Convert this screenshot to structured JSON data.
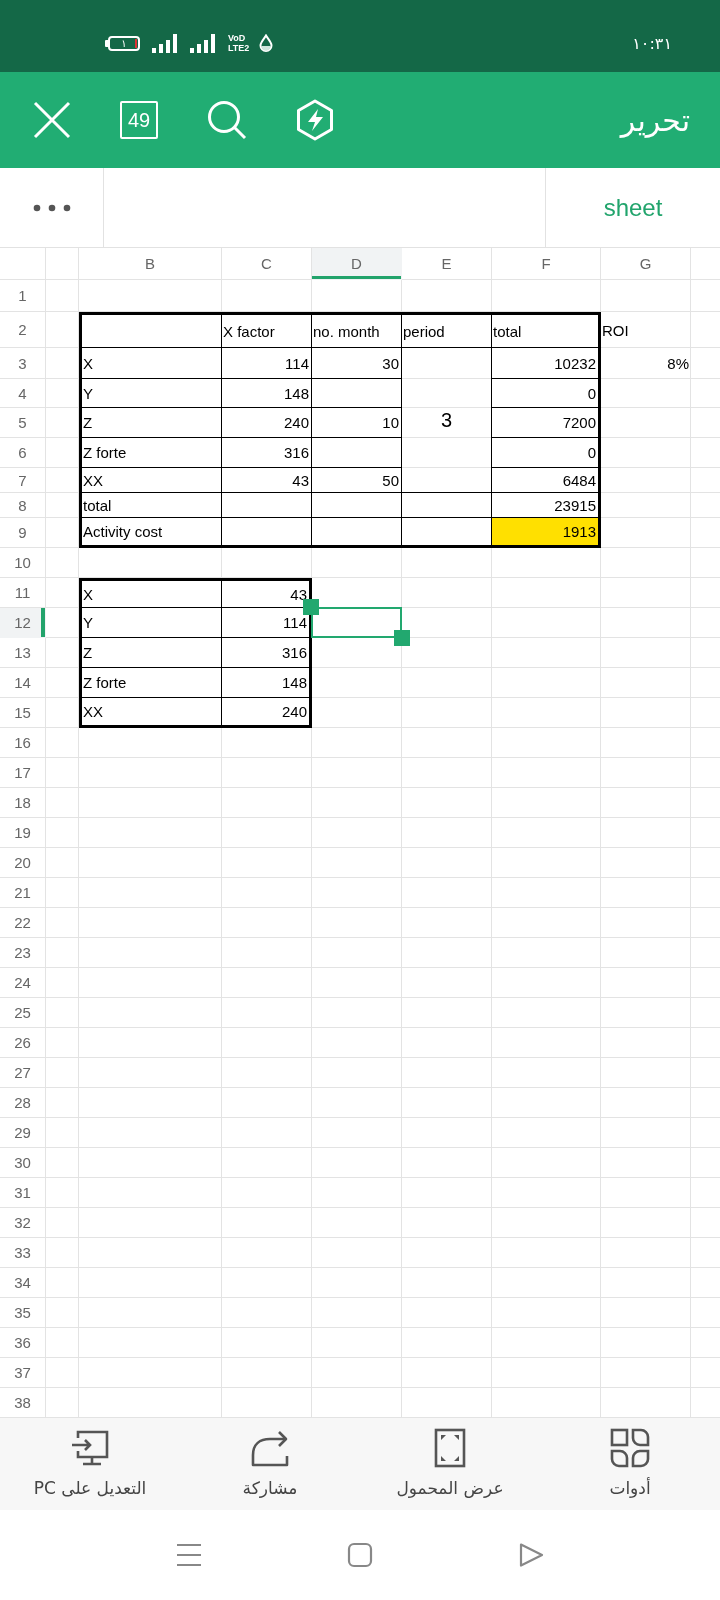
{
  "status_bar": {
    "battery_text": "١",
    "network_top": "VoD",
    "network_bottom": "LTE2",
    "time": "١٠:٣١"
  },
  "toolbar": {
    "page_count": "49",
    "title": "تحرير"
  },
  "formula_bar": {
    "sheet_tab": "sheet"
  },
  "sheet": {
    "columns": [
      {
        "label": "B",
        "selected": false
      },
      {
        "label": "C",
        "selected": false
      },
      {
        "label": "D",
        "selected": true
      },
      {
        "label": "E",
        "selected": false
      },
      {
        "label": "F",
        "selected": false
      },
      {
        "label": "G",
        "selected": false
      }
    ],
    "rows": [
      {
        "number": "1",
        "selected": false
      },
      {
        "number": "2",
        "selected": false,
        "cells": [
          {
            "kind": "blank",
            "boxed": true
          },
          {
            "kind": "label",
            "text": "X factor",
            "boxed": true
          },
          {
            "kind": "label",
            "text": "no. month",
            "boxed": true
          },
          {
            "kind": "label",
            "text": "period",
            "boxed": true
          },
          {
            "kind": "label",
            "text": "total",
            "boxed": true
          },
          {
            "kind": "label",
            "text": "ROI",
            "boxed": false
          }
        ]
      },
      {
        "number": "3",
        "selected": false,
        "cells": [
          {
            "kind": "label",
            "text": "X",
            "boxed": true
          },
          {
            "kind": "number",
            "text": "114",
            "boxed": true
          },
          {
            "kind": "number",
            "text": "30",
            "boxed": true
          },
          {
            "kind": "merged",
            "text": "3",
            "boxed": true
          },
          {
            "kind": "number",
            "text": "10232",
            "boxed": true
          },
          {
            "kind": "number",
            "text": "8%",
            "boxed": false
          }
        ]
      },
      {
        "number": "4",
        "selected": false,
        "cells": [
          {
            "kind": "label",
            "text": "Y",
            "boxed": true
          },
          {
            "kind": "number",
            "text": "148",
            "boxed": true
          },
          {
            "kind": "blank",
            "boxed": true
          },
          {
            "kind": "covered"
          },
          {
            "kind": "number",
            "text": "0",
            "boxed": true
          }
        ]
      },
      {
        "number": "5",
        "selected": false,
        "cells": [
          {
            "kind": "label",
            "text": "Z",
            "boxed": true
          },
          {
            "kind": "number",
            "text": "240",
            "boxed": true
          },
          {
            "kind": "number",
            "text": "10",
            "boxed": true
          },
          {
            "kind": "covered"
          },
          {
            "kind": "number",
            "text": "7200",
            "boxed": true
          }
        ]
      },
      {
        "number": "6",
        "selected": false,
        "cells": [
          {
            "kind": "label",
            "text": "Z forte",
            "boxed": true
          },
          {
            "kind": "number",
            "text": "316",
            "boxed": true
          },
          {
            "kind": "blank",
            "boxed": true
          },
          {
            "kind": "covered"
          },
          {
            "kind": "number",
            "text": "0",
            "boxed": true
          }
        ]
      },
      {
        "number": "7",
        "selected": false,
        "cells": [
          {
            "kind": "label",
            "text": "XX",
            "boxed": true
          },
          {
            "kind": "number",
            "text": "43",
            "boxed": true
          },
          {
            "kind": "number",
            "text": "50",
            "boxed": true
          },
          {
            "kind": "covered"
          },
          {
            "kind": "number",
            "text": "6484",
            "boxed": true
          }
        ]
      },
      {
        "number": "8",
        "selected": false,
        "cells": [
          {
            "kind": "label",
            "text": "total",
            "boxed": true
          },
          {
            "kind": "blank",
            "boxed": true
          },
          {
            "kind": "blank",
            "boxed": true
          },
          {
            "kind": "blank",
            "boxed": true
          },
          {
            "kind": "number",
            "text": "23915",
            "boxed": true
          }
        ]
      },
      {
        "number": "9",
        "selected": false,
        "cells": [
          {
            "kind": "label",
            "text": "Activity cost",
            "boxed": true
          },
          {
            "kind": "blank",
            "boxed": true
          },
          {
            "kind": "blank",
            "boxed": true
          },
          {
            "kind": "blank",
            "boxed": true
          },
          {
            "kind": "number",
            "text": "1913",
            "boxed": true,
            "color": "#ffe000"
          }
        ]
      },
      {
        "number": "10",
        "selected": false
      },
      {
        "number": "11",
        "selected": false,
        "cells": [
          {
            "kind": "label",
            "text": "X",
            "boxed": true
          },
          {
            "kind": "number",
            "text": "43",
            "boxed": true
          }
        ]
      },
      {
        "number": "12",
        "selected": true,
        "cells": [
          {
            "kind": "label",
            "text": "Y",
            "boxed": true
          },
          {
            "kind": "number",
            "text": "114",
            "boxed": true
          }
        ]
      },
      {
        "number": "13",
        "selected": false,
        "cells": [
          {
            "kind": "label",
            "text": "Z",
            "boxed": true
          },
          {
            "kind": "number",
            "text": "316",
            "boxed": true
          }
        ]
      },
      {
        "number": "14",
        "selected": false,
        "cells": [
          {
            "kind": "label",
            "text": "Z forte",
            "boxed": true
          },
          {
            "kind": "number",
            "text": "148",
            "boxed": true
          }
        ]
      },
      {
        "number": "15",
        "selected": false,
        "cells": [
          {
            "kind": "label",
            "text": "XX",
            "boxed": true
          },
          {
            "kind": "number",
            "text": "240",
            "boxed": true
          }
        ]
      },
      {
        "number": "16",
        "selected": false
      },
      {
        "number": "17",
        "selected": false
      },
      {
        "number": "18",
        "selected": false
      },
      {
        "number": "19",
        "selected": false
      },
      {
        "number": "20",
        "selected": false
      },
      {
        "number": "21",
        "selected": false
      },
      {
        "number": "22",
        "selected": false
      },
      {
        "number": "23",
        "selected": false
      },
      {
        "number": "24",
        "selected": false
      },
      {
        "number": "25",
        "selected": false
      },
      {
        "number": "26",
        "selected": false
      },
      {
        "number": "27",
        "selected": false
      },
      {
        "number": "28",
        "selected": false
      },
      {
        "number": "29",
        "selected": false
      },
      {
        "number": "30",
        "selected": false
      },
      {
        "number": "31",
        "selected": false
      },
      {
        "number": "32",
        "selected": false
      },
      {
        "number": "33",
        "selected": false
      },
      {
        "number": "34",
        "selected": false
      },
      {
        "number": "35",
        "selected": false
      },
      {
        "number": "36",
        "selected": false
      },
      {
        "number": "37",
        "selected": false
      },
      {
        "number": "38",
        "selected": false
      }
    ]
  },
  "bottom_bar": {
    "items": [
      {
        "label": "أدوات"
      },
      {
        "label": "عرض المحمول"
      },
      {
        "label": "مشاركة"
      },
      {
        "label": "التعديل على PC"
      }
    ]
  }
}
